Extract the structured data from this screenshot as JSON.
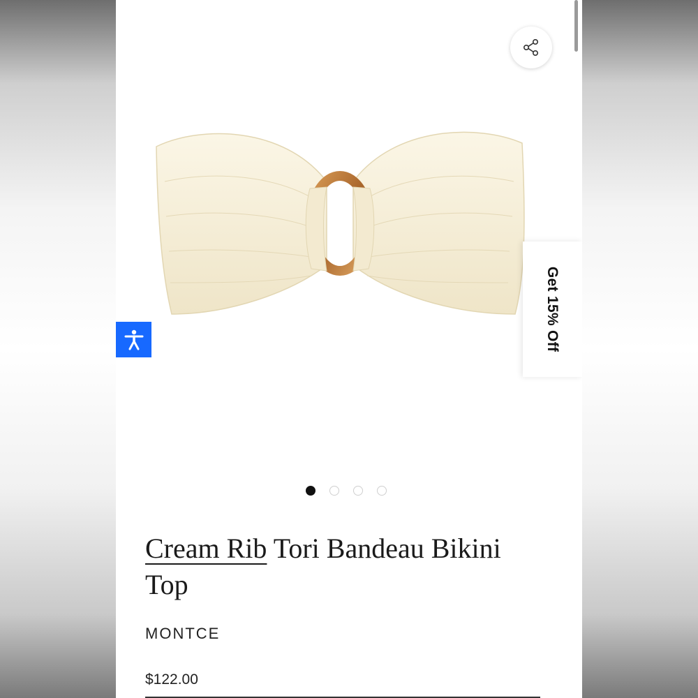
{
  "product": {
    "title_link": "Cream Rib",
    "title_rest": " Tori Bandeau Bikini Top",
    "brand": "MONTCE",
    "price": "$122.00",
    "image_icon": "bikini-top-photo"
  },
  "gallery": {
    "slide_count": 4,
    "active_index": 0
  },
  "promo": {
    "label": "Get 15% Off"
  },
  "icons": {
    "share": "share-icon",
    "accessibility": "accessibility-icon"
  },
  "colors": {
    "accessibility_bg": "#1769ff",
    "active_dot": "#111111",
    "fabric": "#f6efd9",
    "ring": "#b8763a"
  }
}
